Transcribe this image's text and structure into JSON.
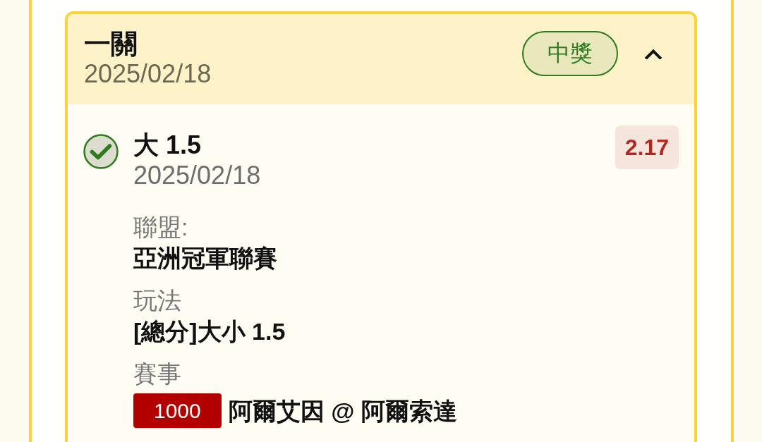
{
  "ticket": {
    "title": "一關",
    "date": "2025/02/18",
    "status": {
      "label": "中獎",
      "kind": "won"
    },
    "expanded": true
  },
  "selections": [
    {
      "won": true,
      "pick": "大 1.5",
      "date": "2025/02/18",
      "odds": "2.17",
      "fields": [
        {
          "kind": "text",
          "label": "聯盟:",
          "value": "亞洲冠軍聯賽"
        },
        {
          "kind": "text",
          "label": "玩法",
          "value": "[總分]大小 1.5"
        },
        {
          "kind": "match",
          "label": "賽事",
          "tag": "1000",
          "value": "阿爾艾因 @ 阿爾索達"
        }
      ]
    }
  ]
}
